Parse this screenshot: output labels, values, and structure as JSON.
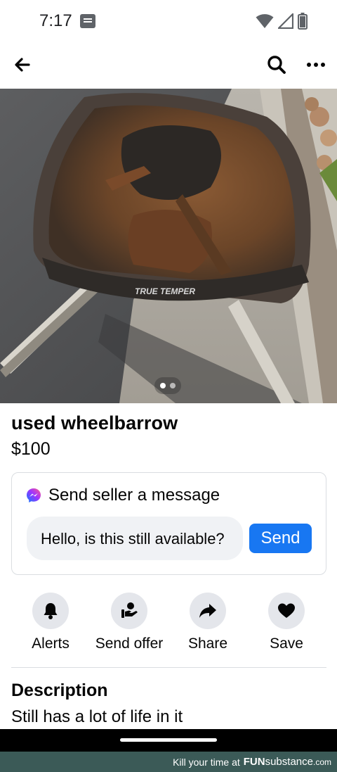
{
  "status_bar": {
    "time": "7:17",
    "icons": [
      "message-notification-icon",
      "wifi-icon",
      "signal-icon",
      "battery-icon"
    ]
  },
  "top_bar": {
    "icons": [
      "back-arrow-icon",
      "search-icon",
      "more-icon"
    ]
  },
  "listing": {
    "photo_count": 2,
    "current_photo": 1,
    "title": "used wheelbarrow",
    "price": "$100",
    "brand_mark": "TRUE TEMPER"
  },
  "message_card": {
    "heading": "Send seller a message",
    "input_value": "Hello, is this still available?",
    "send_label": "Send",
    "accent_color": "#1877f2"
  },
  "actions": [
    {
      "label": "Alerts",
      "icon": "bell-icon"
    },
    {
      "label": "Send offer",
      "icon": "send-offer-icon"
    },
    {
      "label": "Share",
      "icon": "share-arrow-icon"
    },
    {
      "label": "Save",
      "icon": "heart-icon"
    }
  ],
  "description": {
    "heading": "Description",
    "text": "Still has a lot of life in it"
  },
  "watermark": {
    "prefix": "Kill your time at",
    "brand_bold": "FUN",
    "brand_thin": "substance",
    "domain": ".com"
  }
}
